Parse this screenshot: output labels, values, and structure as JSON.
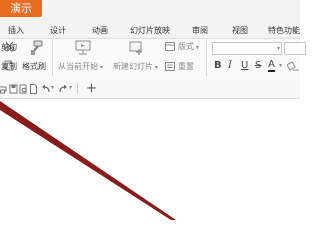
{
  "app": {
    "button_label": "演示"
  },
  "tabs": [
    {
      "label": "插入"
    },
    {
      "label": "设计"
    },
    {
      "label": "动画"
    },
    {
      "label": "幻灯片放映"
    },
    {
      "label": "审阅"
    },
    {
      "label": "视图"
    },
    {
      "label": "特色功能"
    }
  ],
  "ribbon": {
    "cut_label": "剪切",
    "copy_label": "复制",
    "format_painter_label": "格式刷",
    "from_current_label": "从当前开始",
    "new_slide_label": "新建幻灯片",
    "layout_label": "版式",
    "reset_label": "重置",
    "font_name_value": "",
    "font_size_value": "",
    "bold_label": "B",
    "italic_label": "I",
    "underline_label": "U",
    "strikethrough_label": "S",
    "font_color_label": "A"
  },
  "colors": {
    "accent": "#e86d21",
    "line_stroke": "#8b1a1a"
  }
}
